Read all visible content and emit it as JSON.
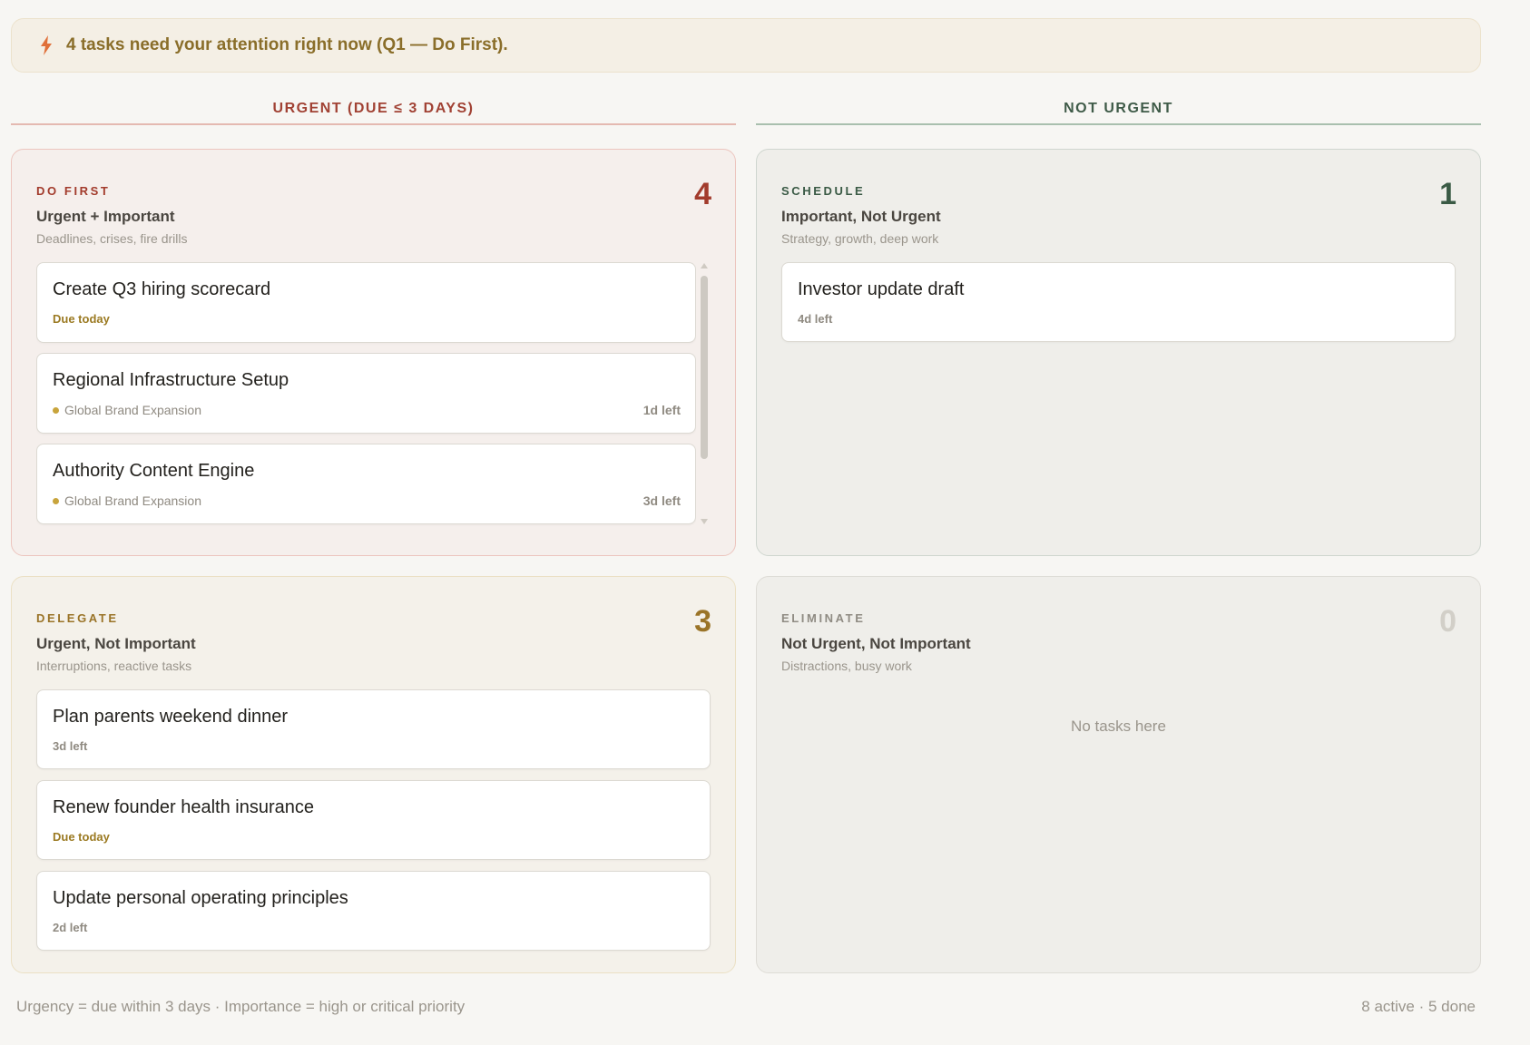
{
  "alert": {
    "text": "4 tasks need your attention right now (Q1 — Do First).",
    "icon": "lightning-icon"
  },
  "columns": {
    "urgent": "URGENT (DUE ≤ 3 DAYS)",
    "not_urgent": "NOT URGENT"
  },
  "quadrants": {
    "q1": {
      "label": "DO FIRST",
      "title": "Urgent + Important",
      "desc": "Deadlines, crises, fire drills",
      "count": "4",
      "tasks": [
        {
          "title": "Create Q3 hiring scorecard",
          "meta": "Due today"
        },
        {
          "title": "Regional Infrastructure Setup",
          "project": "Global Brand Expansion",
          "left": "1d left"
        },
        {
          "title": "Authority Content Engine",
          "project": "Global Brand Expansion",
          "left": "3d left"
        }
      ]
    },
    "q2": {
      "label": "SCHEDULE",
      "title": "Important, Not Urgent",
      "desc": "Strategy, growth, deep work",
      "count": "1",
      "tasks": [
        {
          "title": "Investor update draft",
          "meta": "4d left"
        }
      ]
    },
    "q3": {
      "label": "DELEGATE",
      "title": "Urgent, Not Important",
      "desc": "Interruptions, reactive tasks",
      "count": "3",
      "tasks": [
        {
          "title": "Plan parents weekend dinner",
          "meta": "3d left"
        },
        {
          "title": "Renew founder health insurance",
          "meta": "Due today"
        },
        {
          "title": "Update personal operating principles",
          "meta": "2d left"
        }
      ]
    },
    "q4": {
      "label": "ELIMINATE",
      "title": "Not Urgent, Not Important",
      "desc": "Distractions, busy work",
      "count": "0",
      "empty": "No tasks here"
    }
  },
  "footer": {
    "left": "Urgency = due within 3 days · Importance = high or critical priority",
    "right": "8 active · 5 done"
  },
  "colors": {
    "urgent": "#a23b2c",
    "schedule": "#3a5a45",
    "delegate": "#9a7428",
    "eliminate": "#8f8b83",
    "project_dot": "#c8a43c"
  }
}
